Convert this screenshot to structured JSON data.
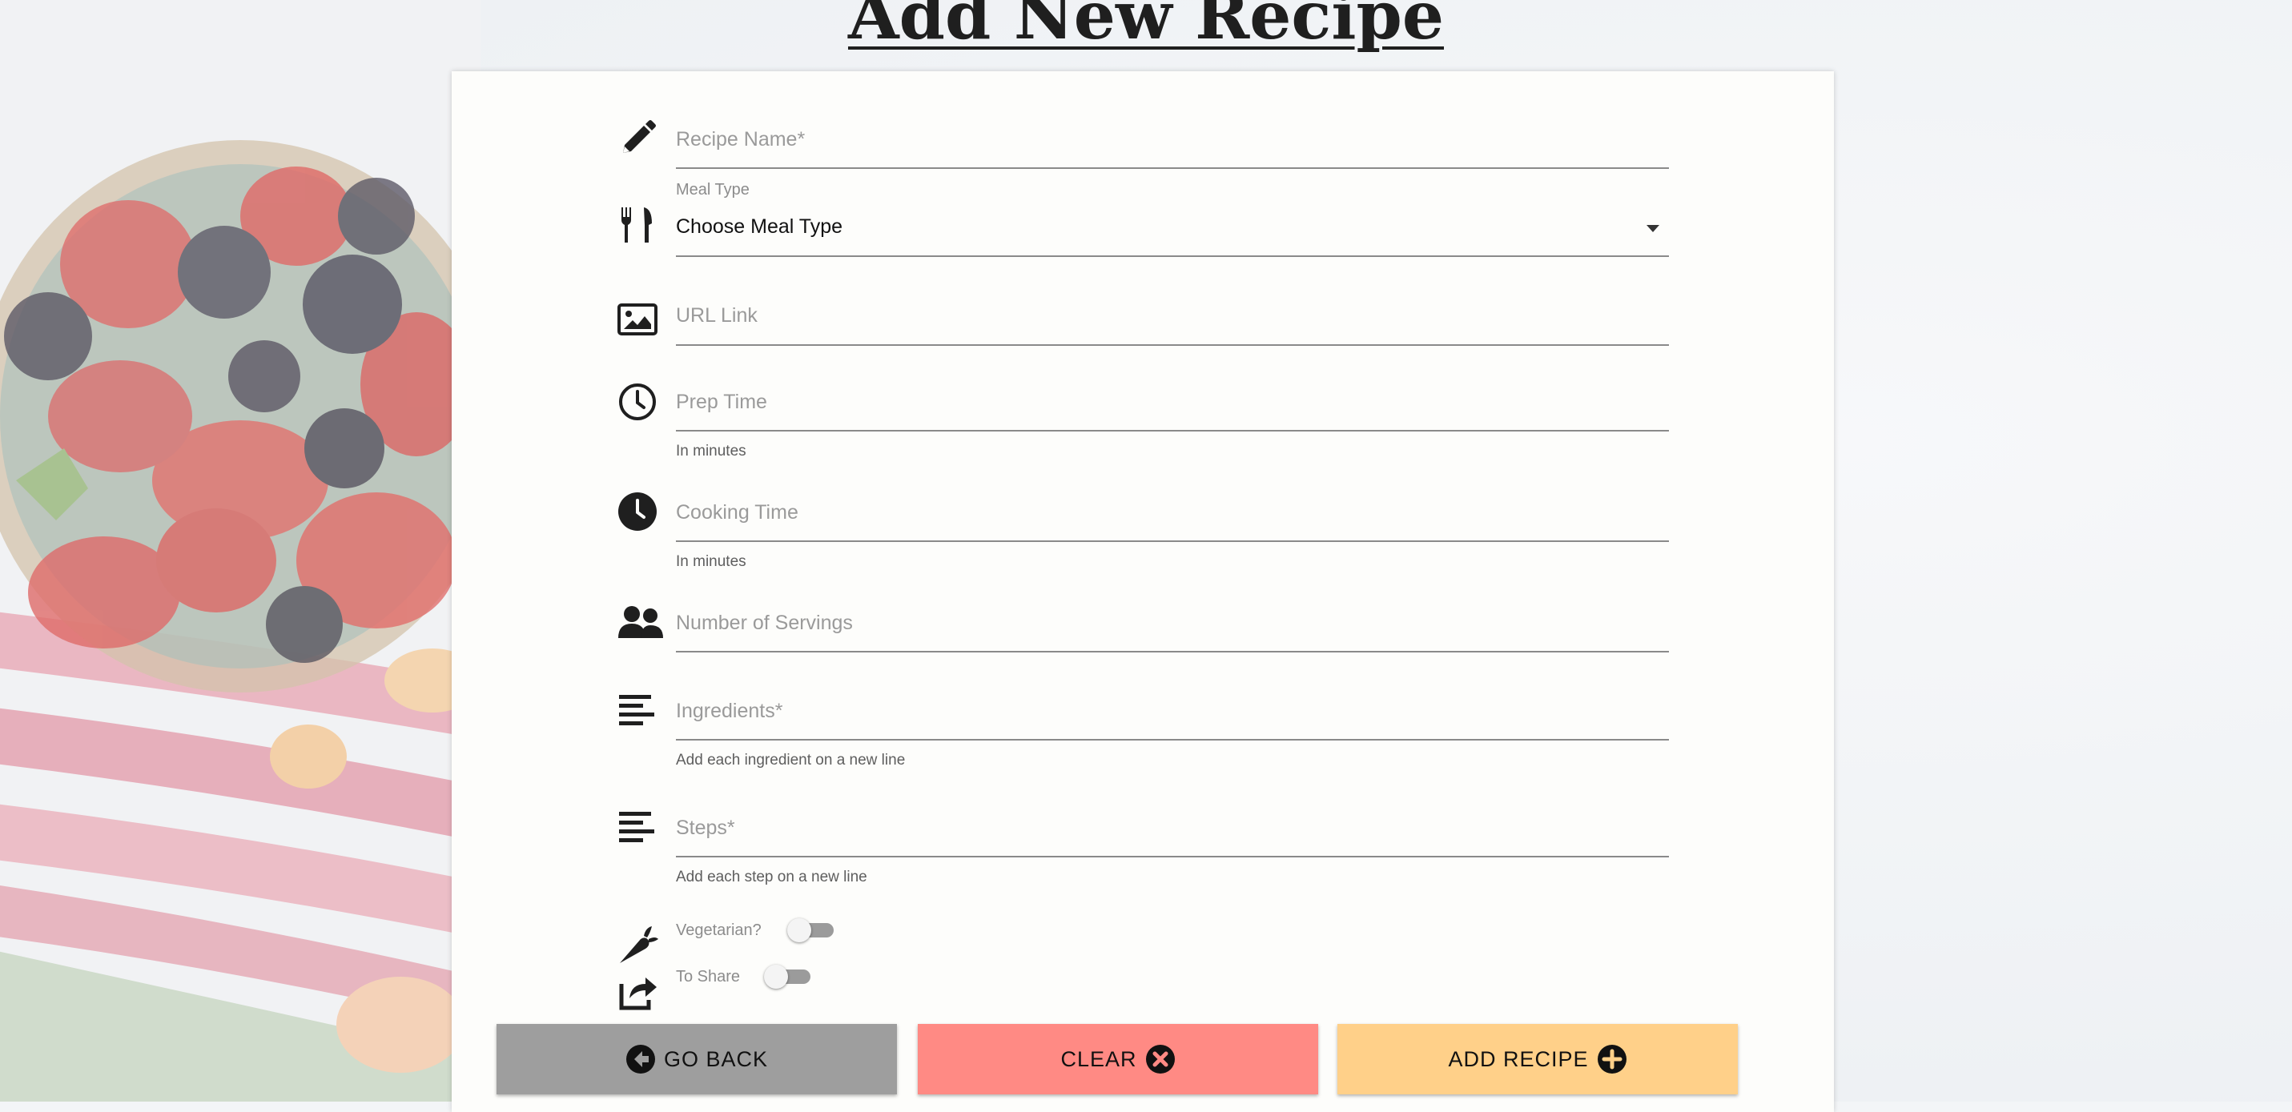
{
  "page": {
    "title": "Add New Recipe"
  },
  "form": {
    "recipe_name": {
      "placeholder": "Recipe Name*",
      "icon": "pencil-icon"
    },
    "meal_type": {
      "label": "Meal Type",
      "value": "Choose Meal Type",
      "icon": "utensils-icon"
    },
    "url_link": {
      "placeholder": "URL Link",
      "icon": "image-icon"
    },
    "prep_time": {
      "placeholder": "Prep Time",
      "helper": "In minutes",
      "icon": "clock-outline-icon"
    },
    "cooking_time": {
      "placeholder": "Cooking Time",
      "helper": "In minutes",
      "icon": "clock-solid-icon"
    },
    "servings": {
      "placeholder": "Number of Servings",
      "icon": "users-icon"
    },
    "ingredients": {
      "placeholder": "Ingredients*",
      "helper": "Add each ingredient on a new line",
      "icon": "align-left-icon"
    },
    "steps": {
      "placeholder": "Steps*",
      "helper": "Add each step on a new line",
      "icon": "align-left-icon"
    },
    "vegetarian": {
      "label": "Vegetarian?",
      "checked": false,
      "icon": "carrot-icon"
    },
    "to_share": {
      "label": "To Share",
      "checked": false,
      "icon": "share-icon"
    }
  },
  "buttons": {
    "go_back": {
      "label": "GO BACK",
      "color": "#9e9e9e",
      "icon": "arrow-left-circle-icon"
    },
    "clear": {
      "label": "CLEAR",
      "color": "#ff8a84",
      "icon": "times-circle-icon"
    },
    "add_recipe": {
      "label": "ADD RECIPE",
      "color": "#ffd089",
      "icon": "plus-circle-icon"
    }
  }
}
